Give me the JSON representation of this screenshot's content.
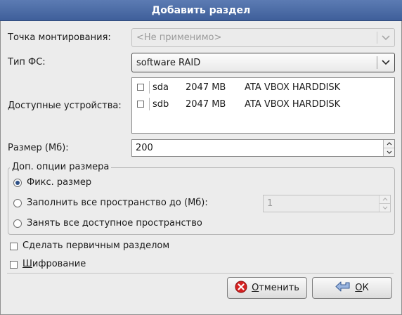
{
  "dialog": {
    "title": "Добавить раздел"
  },
  "mount_point": {
    "label": "Точка монтирования:",
    "value": "<Не применимо>"
  },
  "fs_type": {
    "label": "Тип ФС:",
    "value": "software RAID"
  },
  "devices": {
    "label": "Доступные устройства:",
    "rows": [
      {
        "name": "sda",
        "size": "2047 MB",
        "model": "ATA VBOX HARDDISK",
        "checked": false
      },
      {
        "name": "sdb",
        "size": "2047 MB",
        "model": "ATA VBOX HARDDISK",
        "checked": false
      }
    ]
  },
  "size": {
    "label": "Размер (Мб):",
    "value": "200"
  },
  "size_options": {
    "title": "Доп. опции размера",
    "fixed": "Фикс. размер",
    "fill_upto": "Заполнить все пространство до (Мб):",
    "fill_upto_value": "1",
    "fill_all": "Занять все доступное пространство",
    "selected": "fixed"
  },
  "primary": {
    "label": "Сделать первичным разделом",
    "checked": false
  },
  "encrypt": {
    "label_mnemonic": "Ш",
    "label_rest": "ифрование",
    "checked": false
  },
  "buttons": {
    "cancel_mnemonic": "О",
    "cancel_rest": "тменить",
    "ok_mnemonic": "О",
    "ok_rest": "К"
  },
  "icons": {
    "cancel": "cancel-icon",
    "ok": "ok-arrow-icon",
    "dropdown": "chevron-down-icon"
  },
  "colors": {
    "titlebar": "#4a6aa5",
    "cancel_icon": "#d62020"
  }
}
